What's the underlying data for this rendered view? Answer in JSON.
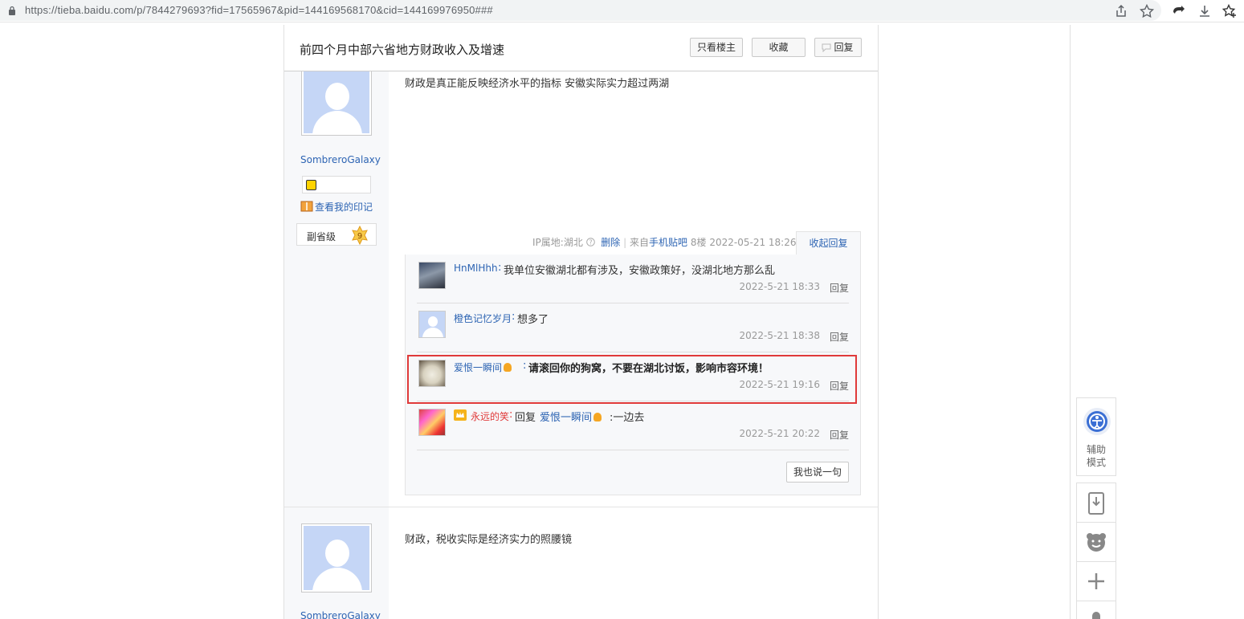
{
  "browser": {
    "url": "https://tieba.baidu.com/p/7844279693?fid=17565967&pid=144169568170&cid=144169976950###",
    "icons": [
      "share-icon",
      "star-icon",
      "extension-icon",
      "download-icon",
      "favorites-icon"
    ]
  },
  "thread": {
    "title": "前四个月中部六省地方财政收入及增速",
    "buttons": {
      "only_op": "只看楼主",
      "collect": "收藏",
      "reply": "回复"
    }
  },
  "post1": {
    "author": "SombreroGalaxy",
    "yinji": "查看我的印记",
    "level_name": "副省级",
    "level_num": "9",
    "content": "财政是真正能反映经济水平的指标 安徽实际实力超过两湖",
    "tail": {
      "ip": "IP属地:湖北",
      "delete": "删除",
      "from_prefix": "来自",
      "from": "手机贴吧",
      "floor": "8楼",
      "time": "2022-05-21 18:26",
      "collapse": "收起回复"
    },
    "replies": [
      {
        "name": "HnMlHhh",
        "sep": ":",
        "text": "我单位安徽湖北都有涉及，安徽政策好，没湖北地方那么乱",
        "time": "2022-5-21 18:33",
        "reply": "回复"
      },
      {
        "name": "橙色记忆岁月",
        "sep": ":",
        "text": "想多了",
        "time": "2022-5-21 18:38",
        "reply": "回复"
      },
      {
        "name": "爱恨一瞬间",
        "sep": ":",
        "text": "请滚回你的狗窝，不要在湖北讨饭，影响市容环境！",
        "time": "2022-5-21 19:16",
        "reply": "回复"
      },
      {
        "name": "永远的笑",
        "sep": ":",
        "pre": "回复",
        "target": "爱恨一瞬间",
        "text": ":一边去",
        "time": "2022-5-21 20:22",
        "reply": "回复"
      }
    ],
    "say_button": "我也说一句"
  },
  "post2": {
    "author": "SombreroGalaxy",
    "content": "财政，税收实际是经济实力的照腰镜"
  },
  "tools": {
    "assist_line1": "辅助",
    "assist_line2": "模式"
  },
  "colors": {
    "link": "#2d64b3",
    "highlight": "#e03a3a",
    "vip_name": "#e03a3a"
  }
}
